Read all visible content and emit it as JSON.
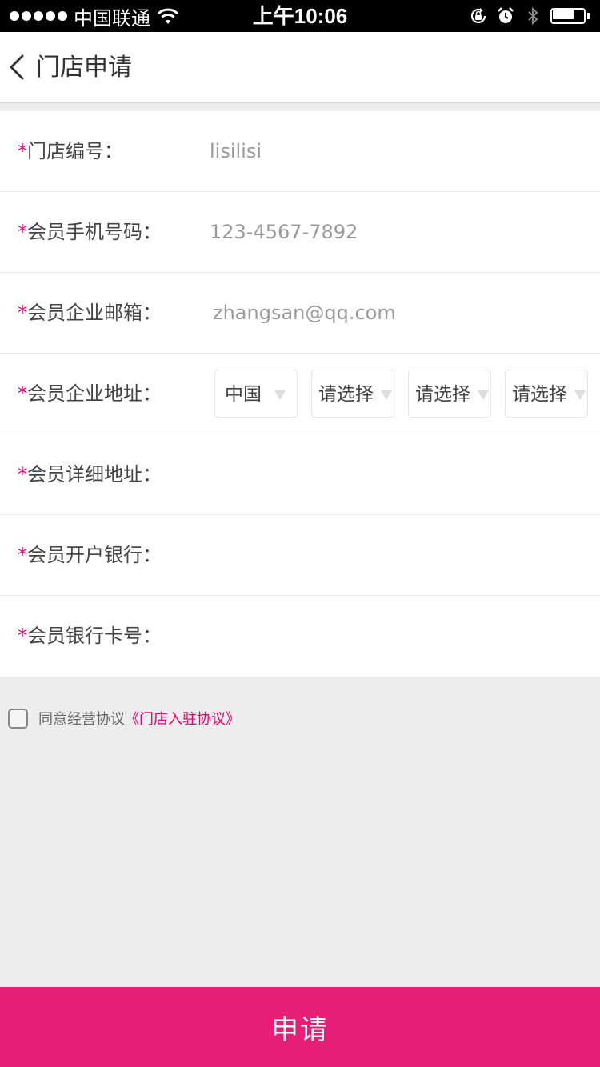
{
  "status_bar": {
    "carrier": "中国联通",
    "time": "上午10:06",
    "battery_level": 0.6
  },
  "navbar": {
    "title": "门店申请"
  },
  "form": {
    "required_mark": "*",
    "store_number": {
      "label": "门店编号：",
      "placeholder": "lisilisi"
    },
    "member_phone": {
      "label": "会员手机号码：",
      "placeholder": "123-4567-7892"
    },
    "company_email": {
      "label": "会员企业邮箱：",
      "placeholder": "zhangsan@qq.com"
    },
    "company_address": {
      "label": "会员企业地址：",
      "selects": [
        "中国",
        "请选择",
        "请选择",
        "请选择"
      ]
    },
    "detail_address": {
      "label": "会员详细地址："
    },
    "bank": {
      "label": "会员开户银行："
    },
    "bank_card": {
      "label": "会员银行卡号："
    }
  },
  "agreement": {
    "text": "同意经营协议",
    "link": "《门店入驻协议》",
    "checked": false
  },
  "submit": {
    "label": "申请"
  },
  "colors": {
    "accent": "#e61e75",
    "required": "#e5006b"
  },
  "icons": [
    "signal-dots-icon",
    "wifi-icon",
    "orientation-lock-icon",
    "alarm-icon",
    "bluetooth-icon",
    "battery-icon",
    "back-chevron-icon",
    "caret-down-icon",
    "checkbox-icon"
  ]
}
